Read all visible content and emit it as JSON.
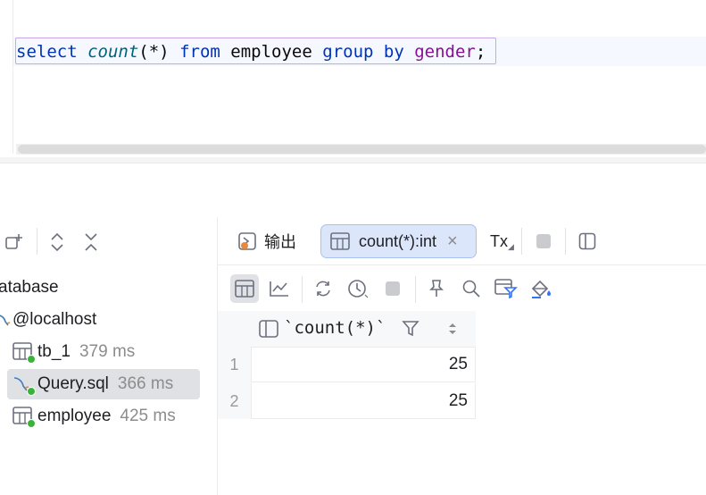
{
  "editor": {
    "query_tokens": {
      "select": "select",
      "count": "count",
      "args": "(*)",
      "from": "from",
      "table": "employee",
      "group_by": "group by",
      "column": "gender",
      "semicolon": ";"
    }
  },
  "left_panel": {
    "tree": [
      {
        "label": "atabase",
        "ms": ""
      },
      {
        "label": "@localhost",
        "ms": ""
      },
      {
        "label": "tb_1",
        "ms": "379 ms"
      },
      {
        "label": "Query.sql",
        "ms": "366 ms"
      },
      {
        "label": "employee",
        "ms": "425 ms"
      }
    ]
  },
  "right_panel": {
    "tabs": {
      "output": "输出",
      "result": "count(*):int",
      "tx": "Tx"
    },
    "grid": {
      "column_header": "`count(*)`",
      "rows": [
        {
          "num": "1",
          "value": "25"
        },
        {
          "num": "2",
          "value": "25"
        }
      ]
    }
  },
  "colors": {
    "keyword": "#0033b3",
    "function": "#00627a",
    "column": "#871094",
    "selection_border": "#c9a6e6",
    "active_tab_bg": "#dbe6fb",
    "status_green": "#3bb33b"
  }
}
